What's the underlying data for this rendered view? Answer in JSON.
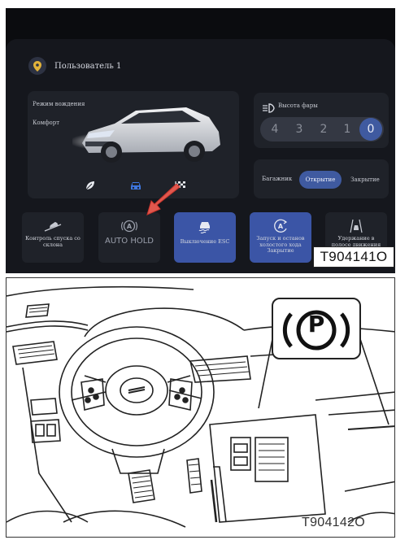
{
  "screen": {
    "user": {
      "name": "Пользователь 1",
      "icon": "location-pin-icon"
    },
    "driving_mode": {
      "title": "Режим вождения",
      "value": "Комфорт",
      "modes": [
        "leaf-eco-icon",
        "car-comfort-icon",
        "checkered-flag-sport-icon"
      ],
      "selected_mode": "car-comfort-icon"
    },
    "headlight": {
      "title": "Высота фары",
      "icon": "headlight-level-icon",
      "steps": [
        "4",
        "3",
        "2",
        "1",
        "0"
      ],
      "selected": "0"
    },
    "trunk": {
      "label": "Багажник",
      "open": "Открытие",
      "close": "Закрытие",
      "selected": "Открытие"
    },
    "tiles": [
      {
        "label": "Контроль спуска со склона",
        "icon": "hill-descent-icon",
        "active": false
      },
      {
        "label": "AUTO HOLD",
        "icon": "auto-hold-icon",
        "active": false
      },
      {
        "label": "Выключение ESC",
        "icon": "esc-off-icon",
        "active": true
      },
      {
        "label": "Запуск и останов холостого хода Закрытие",
        "icon": "auto-start-stop-icon",
        "active": true
      },
      {
        "label": "Удержание в полосе движения",
        "icon": "lane-keep-icon",
        "active": false
      }
    ],
    "pointer": "red-arrow-icon",
    "figure_code": "T904141O",
    "colors": {
      "accent": "#3f5aa0",
      "tile_active": "#3b55a6",
      "background": "#15171d",
      "card": "#1f2229"
    }
  },
  "illustration": {
    "figure_code": "T904142O",
    "callout_icon": "parking-brake-p-icon",
    "callout_symbol": "P"
  }
}
